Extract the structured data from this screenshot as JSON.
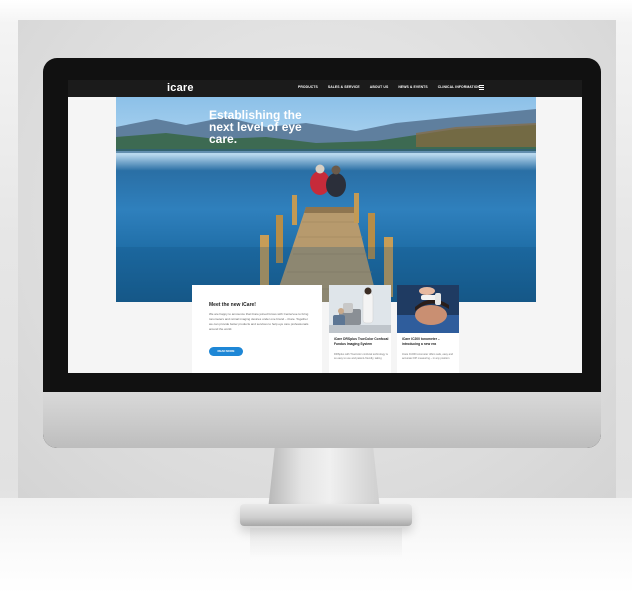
{
  "nav": {
    "logo": "icare",
    "items": [
      {
        "label": "PRODUCTS"
      },
      {
        "label": "SALES & SERVICE"
      },
      {
        "label": "ABOUT US"
      },
      {
        "label": "NEWS & EVENTS"
      },
      {
        "label": "CLINICAL INFORMATION"
      }
    ],
    "menu_icon": "hamburger-menu-icon"
  },
  "hero": {
    "headline": "Establishing the next level of eye care."
  },
  "featured": {
    "title": "Meet the new iCare!",
    "body": "We are happy to announce that iCare joined forces with Centervue to bring tonometers and retinal imaging devices under one brand – iCare. Together we can provide better products and services to help eye care professionals around the world.",
    "button_label": "READ MORE"
  },
  "news": [
    {
      "title": "iCare DRSplus TrueColor Confocal Fundus Imaging System",
      "body": "DRSplus with TrueColor confocal technology is so easy to use and patient-friendly, taking"
    },
    {
      "title": "iCare IC200 tonometer – introducing a new era",
      "body": "iCare IC200 tonometer offers safe, easy and accurate IOP measuring – in any position"
    }
  ],
  "colors": {
    "nav_bg": "#1b1b1b",
    "accent_button": "#1e87d6",
    "bezel": "#111111"
  }
}
